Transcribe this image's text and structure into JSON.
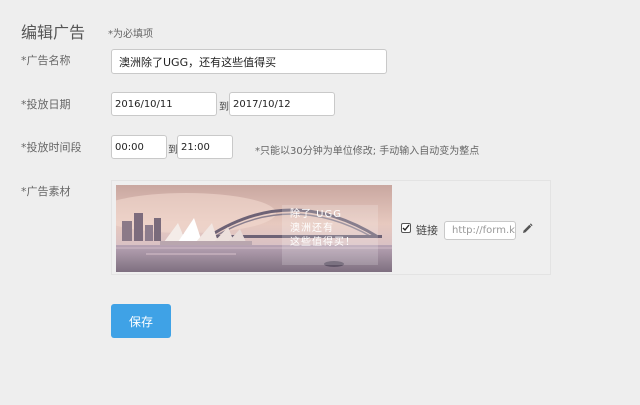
{
  "header": {
    "title": "编辑广告",
    "required_note": "*为必填项"
  },
  "form": {
    "name": {
      "label": "*广告名称",
      "value": "澳洲除了UGG，还有这些值得买"
    },
    "date": {
      "label": "*投放日期",
      "start": "2016/10/11",
      "separator": "到",
      "end": "2017/10/12"
    },
    "time": {
      "label": "*投放时间段",
      "start": "00:00",
      "separator": "到",
      "end": "21:00",
      "hint": "*只能以30分钟为单位修改; 手动输入自动变为整点"
    },
    "material": {
      "label": "*广告素材",
      "banner_lines": [
        "除了 UGG",
        "澳洲还有",
        "这些值得买！"
      ],
      "link_checked": true,
      "link_label": "链接",
      "link_placeholder": "http://form.ki",
      "edit_icon": "pencil-icon"
    }
  },
  "actions": {
    "save_label": "保存",
    "accent_color": "#3fa2e6"
  }
}
